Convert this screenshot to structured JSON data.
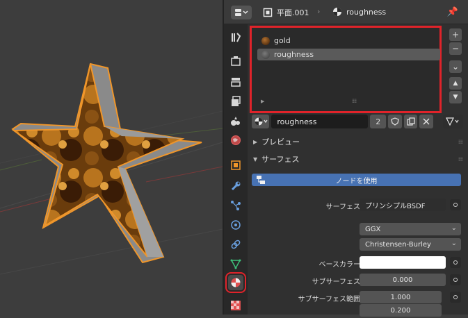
{
  "header": {
    "object_name": "平面.001",
    "material_name": "roughness"
  },
  "material_slots": [
    {
      "label": "gold",
      "color": "#5a3410",
      "selected": false
    },
    {
      "label": "roughness",
      "color": "#4a4a4a",
      "selected": true
    }
  ],
  "slot_buttons": {
    "add": "+",
    "remove": "−",
    "menu": "⌄",
    "up": "▲",
    "down": "▼"
  },
  "material_selector": {
    "name": "roughness",
    "users": "2"
  },
  "panels": {
    "preview": "プレビュー",
    "surface": "サーフェス"
  },
  "use_nodes_label": "ノードを使用",
  "properties": [
    {
      "label": "サーフェス",
      "value": "プリンシプルBSDF"
    },
    {
      "label": "",
      "value": "GGX"
    },
    {
      "label": "",
      "value": "Christensen-Burley"
    },
    {
      "label": "ベースカラー",
      "value": ""
    },
    {
      "label": "サブサーフェス",
      "value": "0.000"
    },
    {
      "label": "サブサーフェス範囲",
      "value": "1.000"
    },
    {
      "label": "",
      "value": "0.200"
    }
  ],
  "colors": {
    "accent_blue": "#4772b3",
    "highlight_red": "#e0232a",
    "outline_orange": "#f0962a"
  }
}
